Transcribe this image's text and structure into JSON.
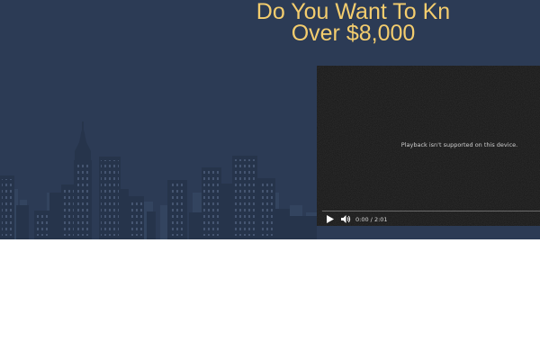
{
  "hero": {
    "background_color": "#2c3b55",
    "headline_color": "#f4cd6e",
    "headline": {
      "line1": "Do You Want To Kn",
      "line2": "Over $8,000"
    }
  },
  "video": {
    "message": "Playback isn't supported on this device.",
    "time": {
      "current": "0:00",
      "total": "2:01"
    },
    "icons": {
      "play": "play-icon",
      "volume": "volume-icon"
    }
  }
}
